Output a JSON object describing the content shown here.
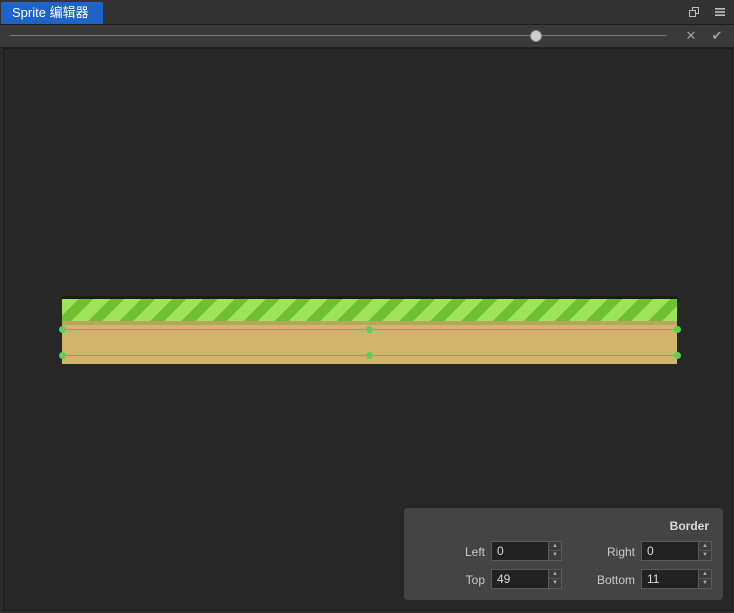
{
  "window": {
    "tab_label": "Sprite 编辑器",
    "restore_icon": "window-restore-icon",
    "menu_icon": "hamburger-menu-icon"
  },
  "toolbar": {
    "zoom_slider_value": 0.8,
    "cancel_icon": "close-icon",
    "confirm_icon": "checkmark-icon"
  },
  "canvas": {
    "background": "#272727",
    "guide_color": "#55d25a"
  },
  "border_panel": {
    "title": "Border",
    "left_label": "Left",
    "left_value": "0",
    "right_label": "Right",
    "right_value": "0",
    "top_label": "Top",
    "top_value": "49",
    "bottom_label": "Bottom",
    "bottom_value": "11"
  },
  "colors": {
    "accent": "#1e63c8",
    "panel": "#444444"
  }
}
